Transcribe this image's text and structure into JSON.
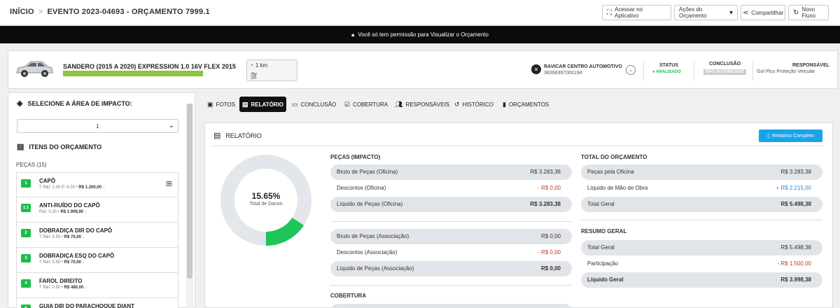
{
  "breadcrumb": {
    "home": "INÍCIO",
    "sep": ">",
    "current": "EVENTO 2023-04693 - ORÇAMENTO 7999.1"
  },
  "toolbar": {
    "app_access": "Acessar no Aplicativo",
    "budget_actions": "Ações do Orçamento",
    "share": "Compartilhar",
    "new_flow": "Novo Fluxo"
  },
  "banner": {
    "text": "Você só tem permissão para Visualizar o Orçamento"
  },
  "vehicle": {
    "title": "SANDERO (2015 A 2020) EXPRESSION 1.0 16V FLEX 2015",
    "km": "1 km",
    "garage_name": "RAVICAR CENTRO AUTOMOTIVO",
    "garage_id": "38398397000194",
    "status_label": "STATUS",
    "status_value": "ANALISADO",
    "conclusion_label": "CONCLUSÃO",
    "conclusion_value": "NÃO AUTORIZADO",
    "responsible_label": "RESPONSÁVEL",
    "responsible_value": "Gol Plus Proteção Veicular"
  },
  "left": {
    "impact_title": "SELECIONE A ÁREA DE IMPACTO:",
    "impact_select": "1",
    "items_title": "ITENS DO ORÇAMENTO",
    "pecas_count": "PEÇAS (15)",
    "items": [
      {
        "num": "1",
        "name": "CAPÔ",
        "detail": "T R&I: 1.00 P: 6.00 • ",
        "price": "R$ 1.200,00",
        "tree": true
      },
      {
        "num": "1.1",
        "name": "ANTI-RUÍDO DO CAPÔ",
        "detail": "R&I: 0.30 • ",
        "price": "R$ 1.908,90",
        "tree": false
      },
      {
        "num": "2",
        "name": "DOBRADIÇA DIR DO CAPÔ",
        "detail": "T R&I: 0.50 • ",
        "price": "R$ 70,00",
        "tree": false
      },
      {
        "num": "3",
        "name": "DOBRADIÇA ESQ DO CAPÔ",
        "detail": "T R&I: 0.50 • ",
        "price": "R$ 70,00",
        "tree": false
      },
      {
        "num": "4",
        "name": "FAROL DIREITO",
        "detail": "T R&I: 0.50 • ",
        "price": "R$ 480,00",
        "tree": false
      },
      {
        "num": "5",
        "name": "GUIA DIR DO PARACHOQUE DIANT",
        "detail": "",
        "price": "",
        "tree": false
      }
    ]
  },
  "tabs": [
    "FOTOS",
    "RELATÓRIO",
    "CONCLUSÃO",
    "COBERTURA",
    "RESPONSÁVEIS",
    "HISTÓRICO",
    "ORÇAMENTOS"
  ],
  "report": {
    "title": "RELATÓRIO",
    "full_button": "Relatório Completo",
    "donut_pct": "15.65%",
    "donut_sub": "Total de Danos",
    "donut_fraction": 0.1565,
    "pecas_head": "PEÇAS (IMPACTO)",
    "pecas_oficina": [
      {
        "label": "Bruto de Peças (Oficina)",
        "value": "R$ 3.283,38"
      },
      {
        "label": "Descontos (Oficina)",
        "value": "- R$ 0,00"
      },
      {
        "label": "Líquido de Peças (Oficina)",
        "value": "R$ 3.283,38"
      }
    ],
    "pecas_assoc": [
      {
        "label": "Bruto de Peças (Associação)",
        "value": "R$ 0,00"
      },
      {
        "label": "Descontos (Associação)",
        "value": "- R$ 0,00"
      },
      {
        "label": "Líquido de Peças (Associação)",
        "value": "R$ 0,00"
      }
    ],
    "cobertura_head": "COBERTURA",
    "total_head": "TOTAL DO ORÇAMENTO",
    "total_rows": [
      {
        "label": "Peças pela Oficina",
        "value": "R$ 3.283,38"
      },
      {
        "label": "Líquido de Mão de Obra",
        "value": "+ R$ 2.215,00"
      },
      {
        "label": "Total Geral",
        "value": "R$ 5.498,38"
      }
    ],
    "resumo_head": "RESUMO GERAL",
    "resumo_rows": [
      {
        "label": "Total Geral",
        "value": "R$ 5.498,38"
      },
      {
        "label": "Participação",
        "value": "- R$ 1.500,00"
      },
      {
        "label": "Líquido Geral",
        "value": "R$ 3.998,38"
      }
    ]
  },
  "colors": {
    "accent_green": "#1bbd4d",
    "link_blue": "#1aa3e8",
    "bar_green": "#8bc53f"
  }
}
